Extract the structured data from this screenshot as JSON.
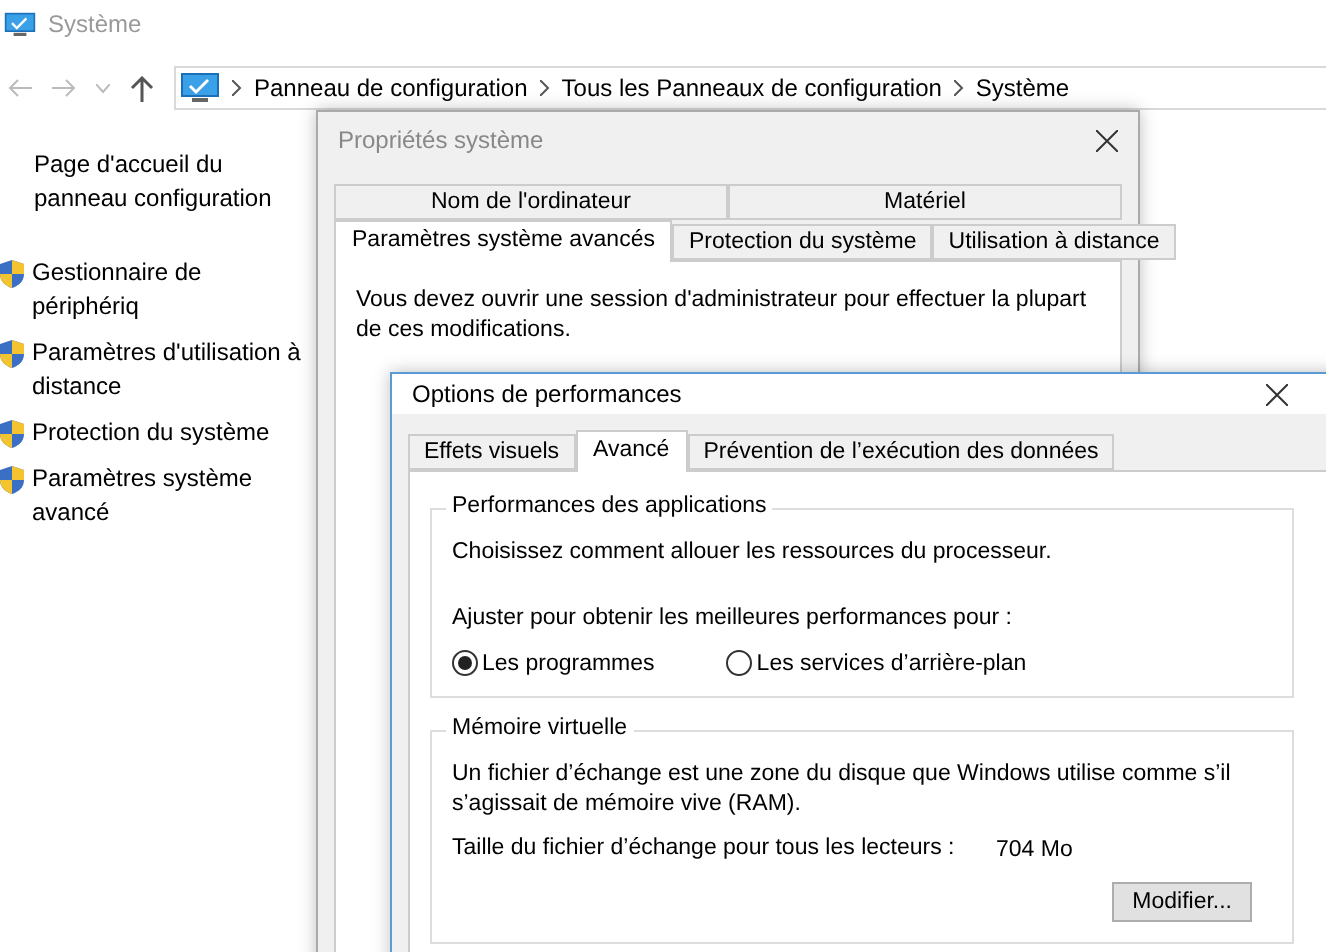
{
  "window": {
    "title": "Système"
  },
  "address_bar": {
    "crumbs": [
      "Panneau de configuration",
      "Tous les Panneaux de configuration",
      "Système"
    ]
  },
  "sidebar": {
    "home_link": "Page d'accueil du panneau configuration",
    "items": [
      {
        "label": "Gestionnaire de périphériq"
      },
      {
        "label": "Paramètres d'utilisation à distance"
      },
      {
        "label": "Protection du système"
      },
      {
        "label": "Paramètres système avancé"
      }
    ]
  },
  "system_properties": {
    "title": "Propriétés système",
    "tabs_back": [
      {
        "label": "Nom de l'ordinateur",
        "selected": false
      },
      {
        "label": "Matériel",
        "selected": false
      }
    ],
    "tabs_front": [
      {
        "label": "Paramètres système avancés",
        "selected": true
      },
      {
        "label": "Protection du système",
        "selected": false
      },
      {
        "label": "Utilisation à distance",
        "selected": false
      }
    ],
    "notice": "Vous devez ouvrir une session d'administrateur pour effectuer la plupart de ces modifications."
  },
  "performance_options": {
    "title": "Options de performances",
    "tabs": [
      {
        "label": "Effets visuels",
        "selected": false
      },
      {
        "label": "Avancé",
        "selected": true
      },
      {
        "label": "Prévention de l’exécution des données",
        "selected": false
      }
    ],
    "app_group": {
      "title": "Performances des applications",
      "description": "Choisissez comment allouer les ressources du processeur.",
      "adjust_label": "Ajuster pour obtenir les meilleures performances pour :",
      "options": [
        {
          "label": "Les programmes",
          "selected": true
        },
        {
          "label": "Les services d’arrière-plan",
          "selected": false
        }
      ]
    },
    "memory_group": {
      "title": "Mémoire virtuelle",
      "description": "Un fichier d’échange est une zone du disque que Windows utilise comme s’il s’agissait de mémoire vive (RAM).",
      "size_label": "Taille du fichier d’échange pour tous les lecteurs :",
      "size_value": "704 Mo",
      "button": "Modifier..."
    }
  }
}
